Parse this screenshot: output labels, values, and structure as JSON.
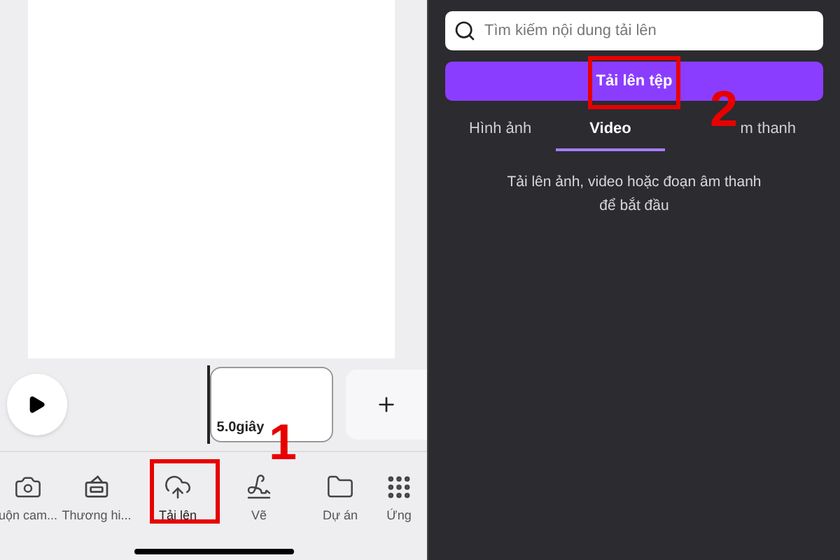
{
  "editor": {
    "clip": {
      "duration": "5.0giây"
    },
    "toolbar": [
      {
        "kind": "camera",
        "label": "uộn cam...",
        "selected": false
      },
      {
        "kind": "brand",
        "label": "Thương hi...",
        "selected": false
      },
      {
        "kind": "upload",
        "label": "Tải lên",
        "selected": true
      },
      {
        "kind": "draw",
        "label": "Vẽ",
        "selected": false
      },
      {
        "kind": "folder",
        "label": "Dự án",
        "selected": false
      },
      {
        "kind": "apps",
        "label": "Ứng",
        "selected": false
      }
    ]
  },
  "uploads": {
    "search": {
      "placeholder": "Tìm kiếm nội dung tải lên"
    },
    "upload_button": "Tải lên tệp",
    "tabs": [
      {
        "label": "Hình ảnh",
        "selected": false
      },
      {
        "label": "Video",
        "selected": true
      },
      {
        "label": "m thanh",
        "selected": false
      }
    ],
    "message": "Tải lên ảnh, video hoặc đoạn âm thanh để bắt đầu"
  },
  "annotations": [
    {
      "label": "1"
    },
    {
      "label": "2"
    }
  ]
}
